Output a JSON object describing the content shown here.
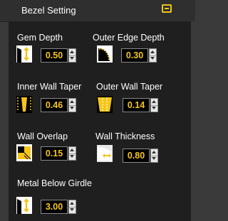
{
  "panel": {
    "title": "Bezel Setting",
    "collapse_icon": "collapse-minus-icon"
  },
  "colors": {
    "accent": "#f5c518",
    "panel_bg": "#1f1f1f",
    "header_bg": "#2f2f2f"
  },
  "fields": {
    "gem_depth": {
      "label": "Gem Depth",
      "value": "0.50",
      "icon": "gem-depth-icon"
    },
    "outer_edge_depth": {
      "label": "Outer Edge Depth",
      "value": "0.30",
      "icon": "outer-edge-depth-icon"
    },
    "inner_wall_taper": {
      "label": "Inner Wall Taper",
      "value": "0.46",
      "icon": "inner-wall-taper-icon"
    },
    "outer_wall_taper": {
      "label": "Outer Wall Taper",
      "value": "0.14",
      "icon": "outer-wall-taper-icon"
    },
    "wall_overlap": {
      "label": "Wall Overlap",
      "value": "0.15",
      "icon": "wall-overlap-icon"
    },
    "wall_thickness": {
      "label": "Wall Thickness",
      "value": "0.80",
      "icon": "wall-thickness-icon"
    },
    "metal_below_girdle": {
      "label": "Metal Below Girdle",
      "value": "3.00",
      "icon": "metal-below-girdle-icon"
    }
  }
}
